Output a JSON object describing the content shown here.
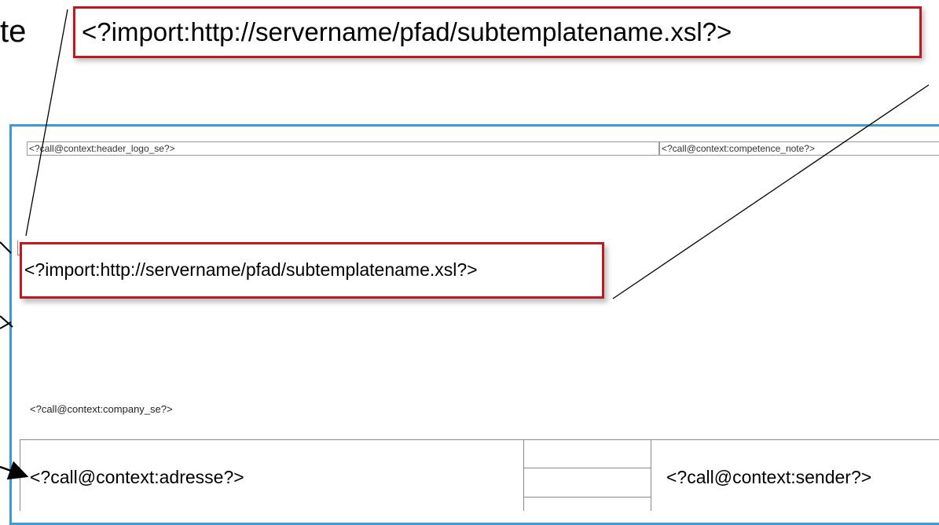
{
  "top_callout": {
    "text": "<?import:http://servername/pfad/subtemplatename.xsl?>"
  },
  "partial_label": "te",
  "document": {
    "header_left": "<?call@context:header_logo_se?>",
    "header_right": "<?call@context:competence_note?>",
    "import_callout": "<?import:http://servername/pfad/subtemplatename.xsl?>",
    "company": "<?call@context:company_se?>",
    "address": "<?call@context:adresse?>",
    "sender": "<?call@context:sender?>"
  },
  "colors": {
    "callout_border": "#c0181f",
    "frame_border": "#3d9bd1"
  }
}
